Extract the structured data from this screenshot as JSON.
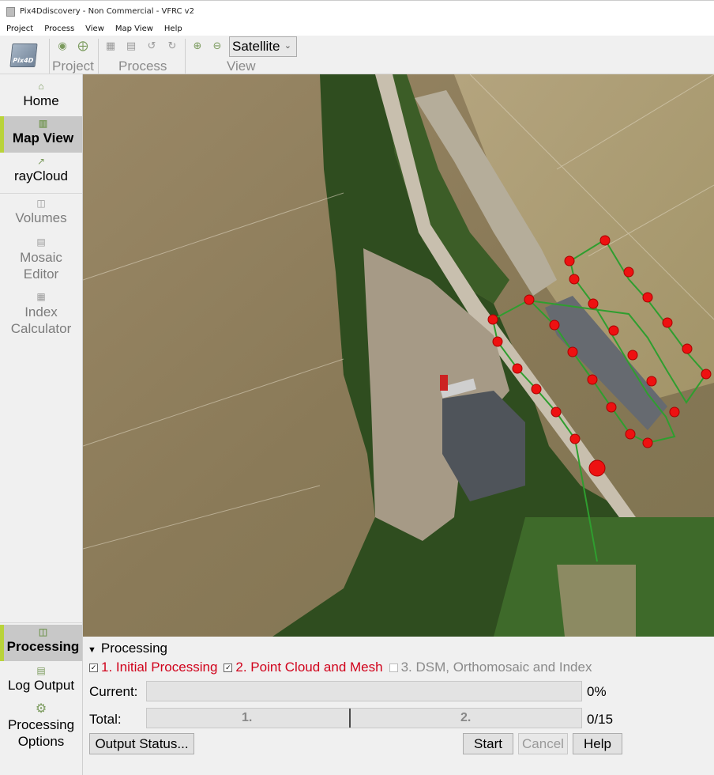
{
  "window": {
    "title": "Pix4Ddiscovery - Non Commercial - VFRC v2"
  },
  "menu": [
    "Project",
    "Process",
    "View",
    "Map View",
    "Help"
  ],
  "toolbar": {
    "logo_text": "Pix4D",
    "groups": {
      "project": "Project",
      "process": "Process",
      "view": "View"
    },
    "view_select": "Satellite"
  },
  "sidebar": {
    "home": "Home",
    "map_view": "Map View",
    "raycloud": "rayCloud",
    "volumes": "Volumes",
    "mosaic_editor_1": "Mosaic",
    "mosaic_editor_2": "Editor",
    "index_calculator_1": "Index",
    "index_calculator_2": "Calculator",
    "processing": "Processing",
    "log_output": "Log Output",
    "processing_options_1": "Processing",
    "processing_options_2": "Options"
  },
  "colors": {
    "accent": "#b9d33a",
    "step_active": "#d0021b",
    "flight_line": "#2f9e2f",
    "waypoint": "#ee1111"
  },
  "processing": {
    "title": "Processing",
    "steps": [
      {
        "label": "1. Initial Processing",
        "checked": true,
        "active": true
      },
      {
        "label": "2. Point Cloud and Mesh",
        "checked": true,
        "active": true
      },
      {
        "label": "3. DSM, Orthomosaic and Index",
        "checked": false,
        "active": false
      }
    ],
    "current_label": "Current:",
    "current_progress": 0,
    "current_value": "0%",
    "total_label": "Total:",
    "total_segments": [
      "1.",
      "2."
    ],
    "total_value": "0/15",
    "buttons": {
      "output_status": "Output Status...",
      "start": "Start",
      "cancel": "Cancel",
      "help": "Help"
    }
  }
}
